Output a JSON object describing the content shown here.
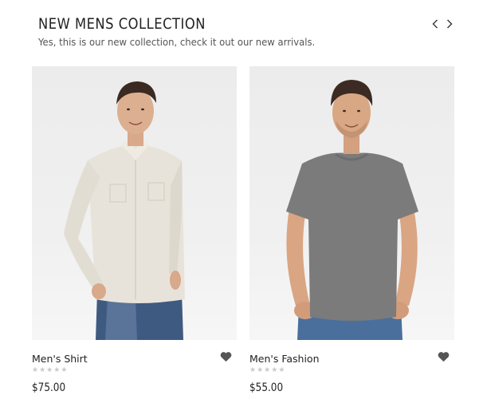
{
  "section": {
    "title": "NEW MENS COLLECTION",
    "subtitle": "Yes, this is our new collection, check it out our new arrivals."
  },
  "navigation": {
    "prev_icon": "chevron-left-icon",
    "next_icon": "chevron-right-icon"
  },
  "products": [
    {
      "name": "Men's Shirt",
      "price": "$75.00",
      "rating": 0,
      "max_rating": 5,
      "wishlist_icon": "heart-icon"
    },
    {
      "name": "Men's Fashion",
      "price": "$55.00",
      "rating": 0,
      "max_rating": 5,
      "wishlist_icon": "heart-icon"
    }
  ],
  "colors": {
    "text": "#222222",
    "subtext": "#555555",
    "star_empty": "#c9c9c9",
    "heart": "#555555",
    "image_bg": "#efefef"
  }
}
